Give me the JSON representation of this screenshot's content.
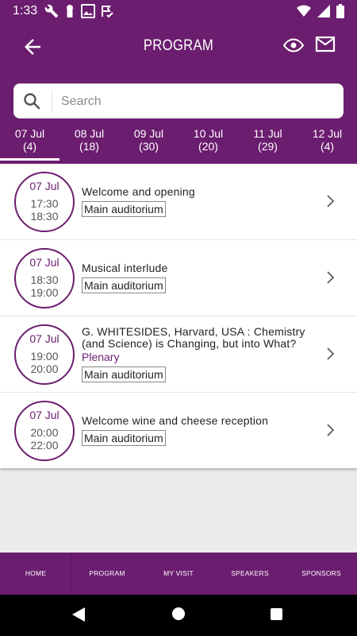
{
  "status": {
    "time": "1:33",
    "left_icons": [
      "wrench-icon",
      "keyhole-icon",
      "image-icon",
      "flag-check-icon"
    ],
    "right_icons": [
      "wifi-icon",
      "signal-icon",
      "battery-icon"
    ]
  },
  "app_bar": {
    "title": "PROGRAM",
    "back_icon": "arrow-left-icon",
    "eye_icon": "eye-icon",
    "mail_icon": "mail-icon"
  },
  "search": {
    "placeholder": "Search",
    "value": ""
  },
  "date_tabs": [
    {
      "date": "07 Jul",
      "count": "(4)",
      "active": true
    },
    {
      "date": "08 Jul",
      "count": "(18)"
    },
    {
      "date": "09 Jul",
      "count": "(30)"
    },
    {
      "date": "10 Jul",
      "count": "(20)"
    },
    {
      "date": "11 Jul",
      "count": "(29)"
    },
    {
      "date": "12 Jul",
      "count": "(4)"
    }
  ],
  "events": [
    {
      "date": "07 Jul",
      "start": "17:30",
      "end": "18:30",
      "title": "Welcome and opening",
      "room": "Main auditorium"
    },
    {
      "date": "07 Jul",
      "start": "18:30",
      "end": "19:00",
      "title": "Musical interlude",
      "room": "Main auditorium"
    },
    {
      "date": "07 Jul",
      "start": "19:00",
      "end": "20:00",
      "title": "G. WHITESIDES, Harvard, USA : Chemistry (and Science) is Changing, but into What?",
      "category": "Plenary",
      "room": "Main auditorium"
    },
    {
      "date": "07 Jul",
      "start": "20:00",
      "end": "22:00",
      "title": "Welcome wine and cheese reception",
      "room": "Main auditorium"
    }
  ],
  "bottom_nav": [
    "HOME",
    "PROGRAM",
    "MY VISIT",
    "SPEAKERS",
    "SPONSORS"
  ],
  "colors": {
    "brand": "#6b1d6f",
    "background": "#ebebeb"
  }
}
